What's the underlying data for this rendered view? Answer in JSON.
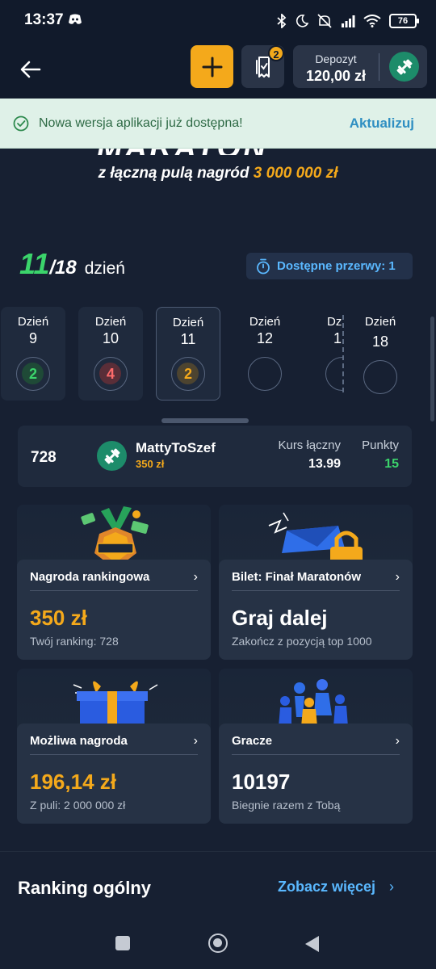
{
  "status_bar": {
    "time": "13:37",
    "battery": "76"
  },
  "header": {
    "ticket_badge": "2",
    "deposit_label": "Depozyt",
    "deposit_amount": "120,00 zł"
  },
  "banner": {
    "text": "Nowa wersja aplikacji już dostępna!",
    "action": "Aktualizuj"
  },
  "hero": {
    "title_fragment": "MARATON",
    "subtitle_prefix": "z łączną pulą nagród",
    "subtitle_amount": "3 000 000 zł"
  },
  "day_counter": {
    "current": "11",
    "total": "/18",
    "word": "dzień",
    "breaks_label": "Dostępne przerwy: 1"
  },
  "days": [
    {
      "label": "Dzień",
      "num": "9",
      "score": "2",
      "state": "done-green"
    },
    {
      "label": "Dzień",
      "num": "10",
      "score": "4",
      "state": "done-red"
    },
    {
      "label": "Dzień",
      "num": "11",
      "score": "2",
      "state": "active"
    },
    {
      "label": "Dzień",
      "num": "12",
      "score": "",
      "state": "future"
    },
    {
      "label": "Dzi",
      "num": "1",
      "score": "",
      "state": "future-cut"
    },
    {
      "label": "Dzień",
      "num": "18",
      "score": "",
      "state": "future"
    }
  ],
  "player": {
    "rank": "728",
    "name": "MattyToSzef",
    "prize": "350 zł",
    "kurs_label": "Kurs łączny",
    "kurs_value": "13.99",
    "points_label": "Punkty",
    "points_value": "15"
  },
  "cards": [
    {
      "title": "Nagroda rankingowa",
      "value": "350 zł",
      "sub": "Twój ranking: 728",
      "gold": true
    },
    {
      "title": "Bilet: Finał Maratonów",
      "value": "Graj dalej",
      "sub": "Zakończ z pozycją top 1000",
      "gold": false
    },
    {
      "title": "Możliwa nagroda",
      "value": "196,14 zł",
      "sub": "Z puli: 2 000 000 zł",
      "gold": true
    },
    {
      "title": "Gracze",
      "value": "10197",
      "sub": "Biegnie razem z Tobą",
      "gold": false
    }
  ],
  "ranking": {
    "title": "Ranking ogólny",
    "link": "Zobacz więcej"
  },
  "colors": {
    "background": "#172032",
    "accent": "#f4a91b",
    "green": "#3bd46b",
    "link_blue": "#5ab8ff",
    "card": "#263245"
  }
}
